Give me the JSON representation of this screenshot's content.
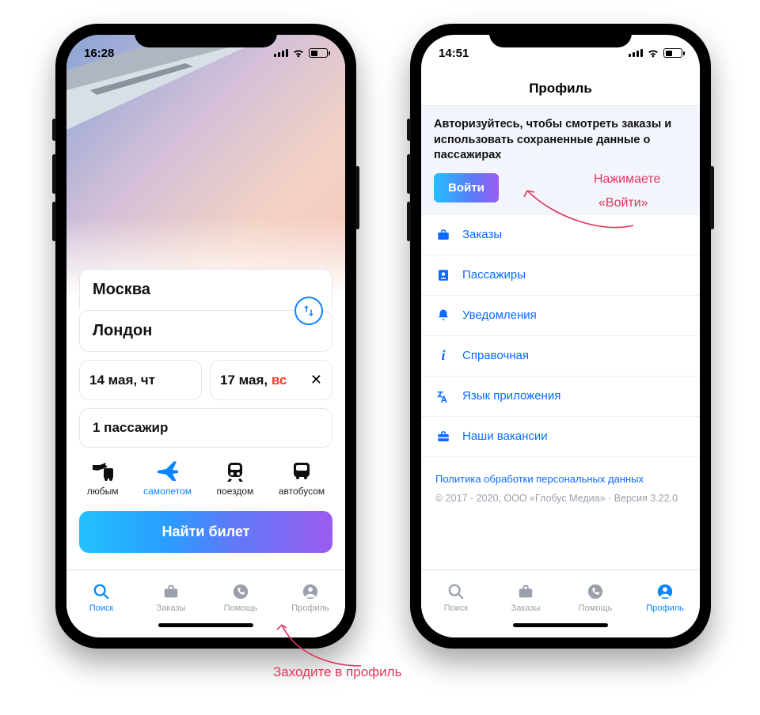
{
  "phone1": {
    "status_time": "16:28",
    "from_city": "Москва",
    "to_city": "Лондон",
    "date_out": "14 мая, чт",
    "date_back_prefix": "17 мая, ",
    "date_back_day": "вс",
    "pax": "1 пассажир",
    "transport": {
      "any": "любым",
      "plane": "самолетом",
      "train": "поездом",
      "bus": "автобусом"
    },
    "main_button": "Найти билет",
    "tabs": {
      "search": "Поиск",
      "orders": "Заказы",
      "help": "Помощь",
      "profile": "Профиль"
    }
  },
  "phone2": {
    "status_time": "14:51",
    "header": "Профиль",
    "banner_text": "Авторизуйтесь, чтобы смотреть заказы и использовать сохраненные данные о пассажирах",
    "login_button": "Войти",
    "menu": {
      "orders": "Заказы",
      "passengers": "Пассажиры",
      "notifications": "Уведомления",
      "help": "Справочная",
      "language": "Язык приложения",
      "jobs": "Наши вакансии"
    },
    "legal_link": "Политика обработки персональных данных",
    "legal_text": "© 2017 - 2020, ООО «Глобус Медиа» · Версия 3.22.0",
    "tabs": {
      "search": "Поиск",
      "orders": "Заказы",
      "help": "Помощь",
      "profile": "Профиль"
    }
  },
  "annotations": {
    "goto_profile": "Заходите в профиль",
    "press_login_line1": "Нажимаете",
    "press_login_line2": "«Войти»"
  }
}
